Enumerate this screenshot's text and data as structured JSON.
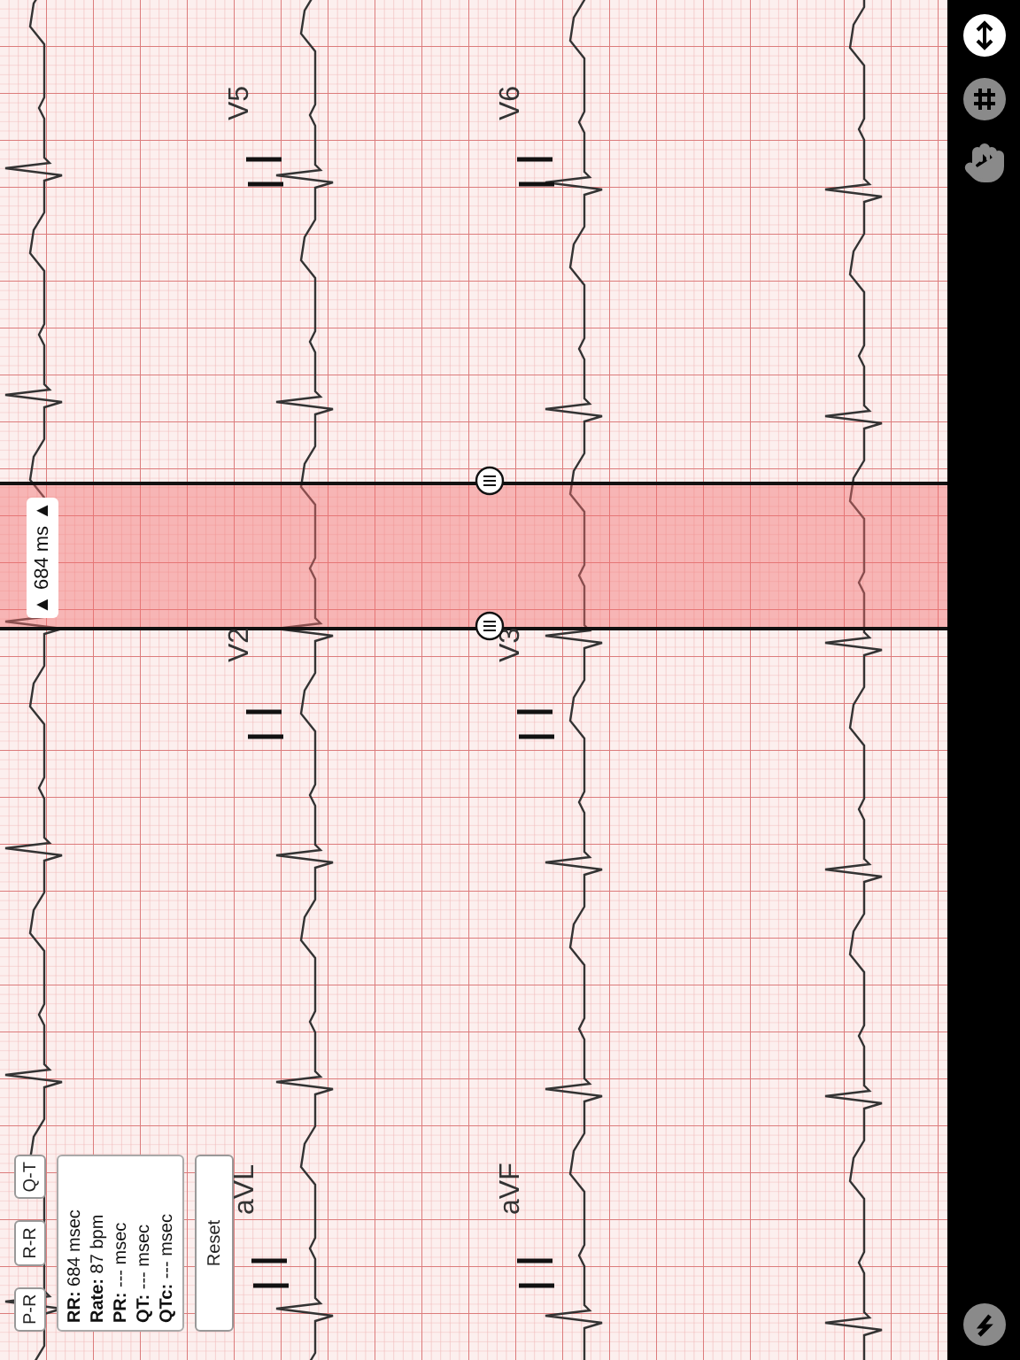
{
  "ecg": {
    "leads": [
      {
        "label": "V5"
      },
      {
        "label": "V6"
      },
      {
        "label": "V2"
      },
      {
        "label": "V3"
      },
      {
        "label": "aVL"
      },
      {
        "label": "aVF"
      }
    ],
    "caliper": {
      "reading": "▲ 684 ms ▲"
    }
  },
  "measure_panel": {
    "modes": [
      {
        "label": "P-R",
        "selected": false
      },
      {
        "label": "R-R",
        "selected": false
      },
      {
        "label": "Q-T",
        "selected": false
      }
    ],
    "results": [
      "**RR:** 684 msec",
      "**Rate:** 87 bpm",
      "**PR:** --- msec",
      "**QT:** --- msec",
      "**QTc:** --- msec"
    ],
    "reset": "Reset"
  },
  "sidebar": {
    "tools": [
      {
        "kind": "scroll",
        "selected": true
      },
      {
        "kind": "grid",
        "selected": false
      },
      {
        "kind": "hand",
        "selected": false
      }
    ],
    "back": {
      "kind": "back"
    }
  }
}
